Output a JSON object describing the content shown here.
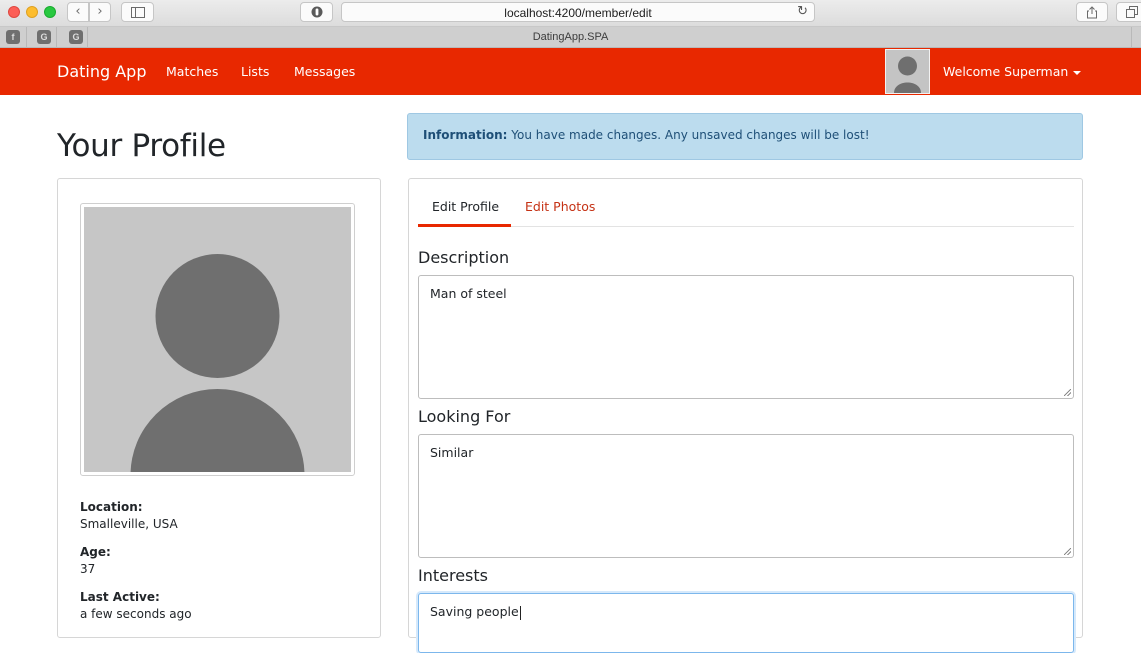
{
  "browser": {
    "url": "localhost:4200/member/edit",
    "tab_title": "DatingApp.SPA",
    "pinned_tab_glyphs": [
      "f",
      "G",
      "G"
    ],
    "icons": [
      "back-icon",
      "forward-icon",
      "sidebar-icon",
      "shield-icon",
      "reload-icon",
      "share-icon",
      "tabs-icon"
    ]
  },
  "navbar": {
    "brand": "Dating App",
    "links": [
      "Matches",
      "Lists",
      "Messages"
    ],
    "welcome": "Welcome Superman",
    "color": "#e82800"
  },
  "page": {
    "title": "Your Profile",
    "alert": {
      "label": "Information:",
      "message": "You have made changes. Any unsaved changes will be lost!"
    }
  },
  "profile": {
    "location_label": "Location:",
    "location": "Smalleville, USA",
    "age_label": "Age:",
    "age": "37",
    "last_active_label": "Last Active:",
    "last_active": "a few seconds ago"
  },
  "edit": {
    "tabs": [
      "Edit Profile",
      "Edit Photos"
    ],
    "description_label": "Description",
    "description": "Man of steel",
    "looking_for_label": "Looking For",
    "looking_for": "Similar",
    "interests_label": "Interests",
    "interests": "Saving people"
  }
}
